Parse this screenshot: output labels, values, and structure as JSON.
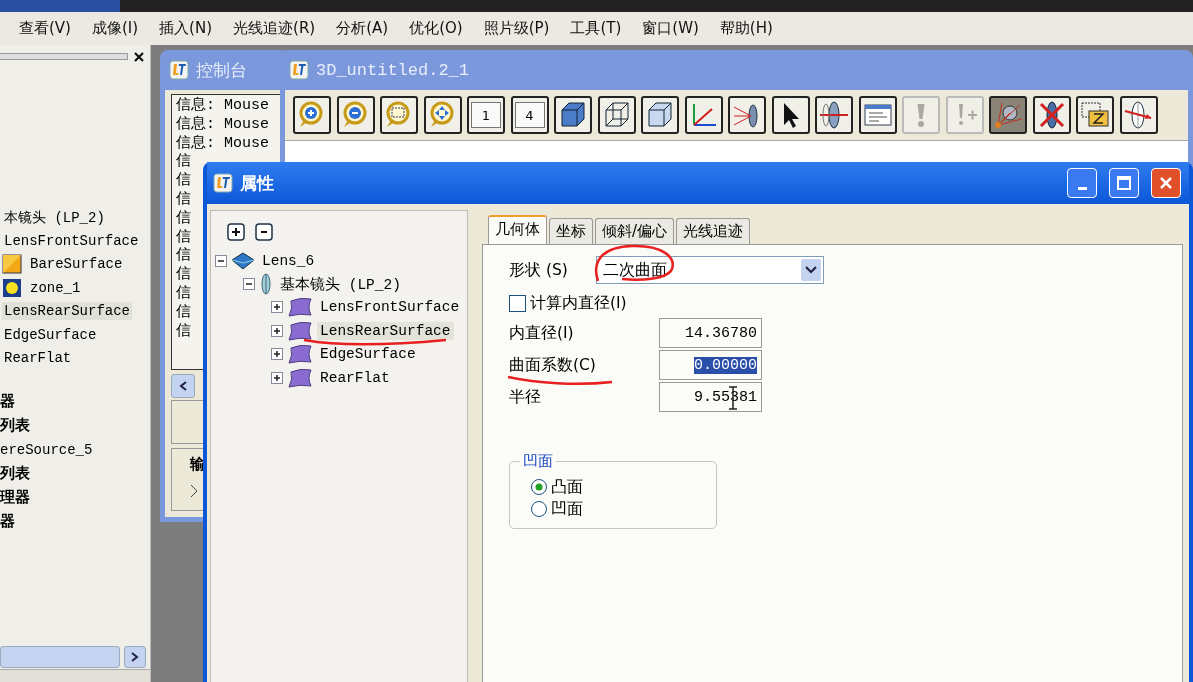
{
  "menu_bar": [
    {
      "label": "查看(V)"
    },
    {
      "label": "成像(I)"
    },
    {
      "label": "插入(N)"
    },
    {
      "label": "光线追迹(R)"
    },
    {
      "label": "分析(A)"
    },
    {
      "label": "优化(O)"
    },
    {
      "label": "照片级(P)"
    },
    {
      "label": "工具(T)"
    },
    {
      "label": "窗口(W)"
    },
    {
      "label": "帮助(H)"
    }
  ],
  "side_panel": {
    "tree": [
      {
        "label": "本镜头 (LP_2)",
        "kind": "node",
        "selected": false
      },
      {
        "label": "LensFrontSurface",
        "kind": "node",
        "selected": false
      },
      {
        "label": "BareSurface",
        "kind": "bare-surface",
        "selected": false
      },
      {
        "label": "zone_1",
        "kind": "zone",
        "selected": false
      },
      {
        "label": "LensRearSurface",
        "kind": "node",
        "selected": true
      },
      {
        "label": "EdgeSurface",
        "kind": "node",
        "selected": false
      },
      {
        "label": "RearFlat",
        "kind": "node",
        "selected": false
      }
    ],
    "sections": [
      {
        "label": "器",
        "kind": "heading"
      },
      {
        "label": "列表",
        "kind": "heading"
      },
      {
        "label": "ereSource_5",
        "kind": "item"
      },
      {
        "label": "列表",
        "kind": "heading"
      },
      {
        "label": "理器",
        "kind": "heading"
      },
      {
        "label": "器",
        "kind": "heading"
      }
    ]
  },
  "console": {
    "title": "控制台",
    "lines": [
      "信息: Mouse",
      "信息: Mouse",
      "信息: Mouse",
      "信",
      "信",
      "信",
      "信",
      "信",
      "信",
      "信",
      "信",
      "信",
      "信"
    ],
    "tab_label": "输"
  },
  "view_window": {
    "title": "3D_untitled.2_1",
    "toolbar": [
      {
        "kind": "zoom-in",
        "disabled": false,
        "pressed": false
      },
      {
        "kind": "zoom-out",
        "disabled": false,
        "pressed": false
      },
      {
        "kind": "zoom-box",
        "disabled": false,
        "pressed": false
      },
      {
        "kind": "zoom-fit",
        "disabled": false,
        "pressed": false
      },
      {
        "kind": "view",
        "label": "1",
        "disabled": false,
        "pressed": false
      },
      {
        "kind": "view",
        "label": "4",
        "disabled": false,
        "pressed": false
      },
      {
        "kind": "cube-solid",
        "disabled": false,
        "pressed": false
      },
      {
        "kind": "cube-wire",
        "disabled": false,
        "pressed": false
      },
      {
        "kind": "cube-shaded",
        "disabled": false,
        "pressed": false
      },
      {
        "kind": "axes",
        "disabled": false,
        "pressed": false
      },
      {
        "kind": "ray-lens",
        "disabled": false,
        "pressed": false
      },
      {
        "kind": "pointer",
        "disabled": false,
        "pressed": false
      },
      {
        "kind": "lens-section",
        "disabled": false,
        "pressed": false
      },
      {
        "kind": "form",
        "disabled": false,
        "pressed": false
      },
      {
        "kind": "warning",
        "disabled": true,
        "pressed": false
      },
      {
        "kind": "warning-plus",
        "disabled": true,
        "pressed": false
      },
      {
        "kind": "ray-fan",
        "disabled": false,
        "pressed": true
      },
      {
        "kind": "lens-cross",
        "disabled": false,
        "pressed": false
      },
      {
        "kind": "z-box",
        "disabled": false,
        "pressed": false
      },
      {
        "kind": "lens-arrow",
        "disabled": false,
        "pressed": false
      }
    ]
  },
  "dialog": {
    "title": "属性",
    "tree": [
      {
        "label": "Lens_6",
        "kind": "lens",
        "selected": false,
        "expanded": true,
        "children": [
          {
            "label": "基本镜头 (LP_2)",
            "kind": "lens-group",
            "selected": false,
            "expanded": true,
            "children": [
              {
                "label": "LensFrontSurface",
                "kind": "surface",
                "selected": false,
                "expanded": false
              },
              {
                "label": "LensRearSurface",
                "kind": "surface",
                "selected": true,
                "expanded": false
              },
              {
                "label": "EdgeSurface",
                "kind": "surface",
                "selected": false,
                "expanded": false
              },
              {
                "label": "RearFlat",
                "kind": "surface",
                "selected": false,
                "expanded": false
              }
            ]
          }
        ]
      }
    ],
    "tabs": [
      {
        "label": "几何体",
        "selected": true
      },
      {
        "label": "坐标",
        "selected": false
      },
      {
        "label": "倾斜/偏心",
        "selected": false
      },
      {
        "label": "光线追迹",
        "selected": false
      }
    ],
    "shape": {
      "label": "形状 (S)",
      "value": "二次曲面"
    },
    "compute_checkbox": {
      "label": "计算内直径(I)",
      "checked": false
    },
    "fields": [
      {
        "label": "内直径(I)",
        "value": "14.36780",
        "selected": false
      },
      {
        "label": "曲面系数(C)",
        "value": "0.00000",
        "selected": true
      },
      {
        "label": "半径",
        "value": "9.55381",
        "selected": false
      }
    ],
    "surface_group": {
      "title": "凹面",
      "options": [
        {
          "label": "凸面",
          "selected": true
        },
        {
          "label": "凹面",
          "selected": false
        }
      ]
    }
  }
}
